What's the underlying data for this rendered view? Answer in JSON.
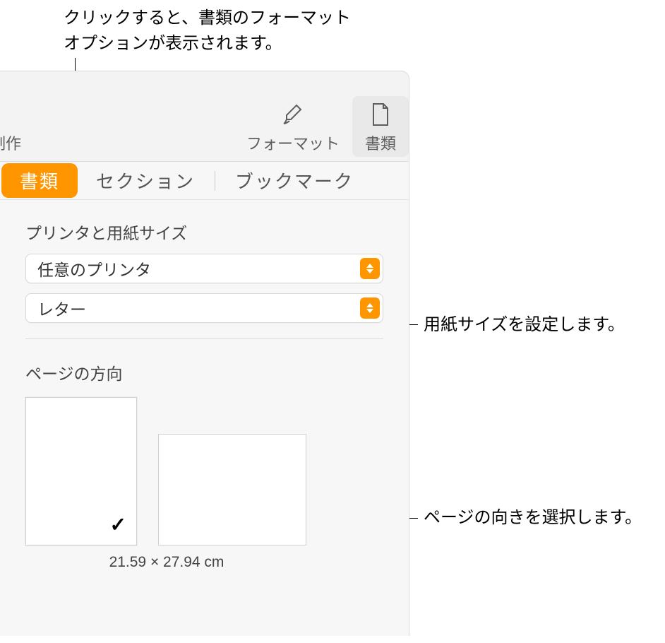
{
  "callouts": {
    "top": "クリックすると、書類のフォーマットオプションが表示されます。",
    "paper_size": "用紙サイズを設定します。",
    "orientation": "ページの向きを選択します。"
  },
  "toolbar": {
    "left_cut_label": "制作",
    "format_label": "フォーマット",
    "document_label": "書類"
  },
  "tabs": {
    "document": "書類",
    "section": "セクション",
    "bookmark": "ブックマーク"
  },
  "sections": {
    "printer_paper_title": "プリンタと用紙サイズ",
    "orientation_title": "ページの方向",
    "dimensions_label": "21.59 × 27.94 cm"
  },
  "popups": {
    "printer_value": "任意のプリンタ",
    "paper_value": "レター"
  },
  "icons": {
    "format": "paintbrush-icon",
    "document": "document-icon",
    "check": "✓"
  }
}
